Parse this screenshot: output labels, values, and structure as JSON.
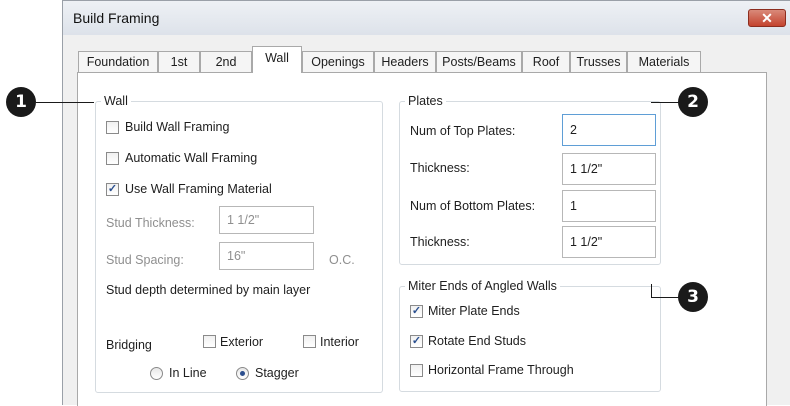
{
  "dialog": {
    "title": "Build Framing",
    "close_label": "✕"
  },
  "tabs": [
    "Foundation",
    "1st",
    "2nd",
    "Wall",
    "Openings",
    "Headers",
    "Posts/Beams",
    "Roof",
    "Trusses",
    "Materials"
  ],
  "active_tab": "Wall",
  "wall": {
    "legend": "Wall",
    "build_wall_framing": {
      "label": "Build Wall Framing",
      "checked": false
    },
    "automatic_wall_framing": {
      "label": "Automatic Wall Framing",
      "checked": false
    },
    "use_wall_framing_material": {
      "label": "Use Wall Framing Material",
      "checked": true
    },
    "stud_thickness": {
      "label": "Stud Thickness:",
      "value": "1 1/2\""
    },
    "stud_spacing": {
      "label": "Stud Spacing:",
      "value": "16\"",
      "suffix": "O.C."
    },
    "stud_depth_note": "Stud depth determined by main layer",
    "bridging": {
      "label": "Bridging",
      "exterior": {
        "label": "Exterior",
        "checked": false
      },
      "interior": {
        "label": "Interior",
        "checked": false
      },
      "in_line": {
        "label": "In Line",
        "selected": false
      },
      "stagger": {
        "label": "Stagger",
        "selected": true
      }
    }
  },
  "plates": {
    "legend": "Plates",
    "num_top_plates": {
      "label": "Num of Top Plates:",
      "value": "2"
    },
    "top_thickness": {
      "label": "Thickness:",
      "value": "1 1/2\""
    },
    "num_bottom_plates": {
      "label": "Num of Bottom Plates:",
      "value": "1"
    },
    "bottom_thickness": {
      "label": "Thickness:",
      "value": "1 1/2\""
    }
  },
  "miter": {
    "legend": "Miter Ends of Angled Walls",
    "miter_plate_ends": {
      "label": "Miter Plate Ends",
      "checked": true
    },
    "rotate_end_studs": {
      "label": "Rotate End Studs",
      "checked": true
    },
    "horizontal_frame_through": {
      "label": "Horizontal Frame Through",
      "checked": false
    }
  },
  "callouts": [
    "1",
    "2",
    "3"
  ],
  "check_glyph": "✓"
}
